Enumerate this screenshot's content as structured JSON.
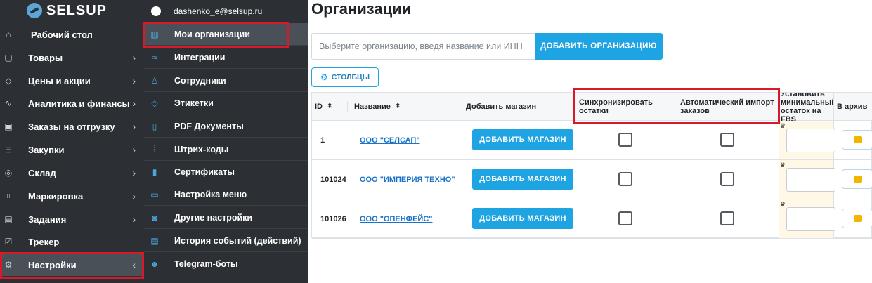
{
  "app": {
    "logo": "SELSUP"
  },
  "sidebar": {
    "items": [
      {
        "label": "Рабочий стол",
        "icon": "home-icon",
        "chevron": ""
      },
      {
        "label": "Товары",
        "icon": "bag-icon",
        "chevron": "›"
      },
      {
        "label": "Цены и акции",
        "icon": "tag-icon",
        "chevron": "›"
      },
      {
        "label": "Аналитика и финансы",
        "icon": "chart-icon",
        "chevron": "›"
      },
      {
        "label": "Заказы на отгрузку",
        "icon": "box-icon",
        "chevron": "›"
      },
      {
        "label": "Закупки",
        "icon": "cart-icon",
        "chevron": "›"
      },
      {
        "label": "Склад",
        "icon": "check-circle-icon",
        "chevron": "›"
      },
      {
        "label": "Маркировка",
        "icon": "scan-icon",
        "chevron": "›"
      },
      {
        "label": "Задания",
        "icon": "calendar-icon",
        "chevron": "›"
      },
      {
        "label": "Трекер",
        "icon": "checkbox-icon",
        "chevron": ""
      },
      {
        "label": "Настройки",
        "icon": "gear-icon",
        "chevron": "‹"
      }
    ]
  },
  "submenu": {
    "user_email": "dashenko_e@selsup.ru",
    "items": [
      {
        "label": "Мои организации",
        "icon": "building-icon"
      },
      {
        "label": "Интеграции",
        "icon": "link-icon"
      },
      {
        "label": "Сотрудники",
        "icon": "user-icon"
      },
      {
        "label": "Этикетки",
        "icon": "tag-icon"
      },
      {
        "label": "PDF Документы",
        "icon": "document-icon"
      },
      {
        "label": "Штрих-коды",
        "icon": "barcode-icon"
      },
      {
        "label": "Сертификаты",
        "icon": "certificate-icon"
      },
      {
        "label": "Настройка меню",
        "icon": "menu-icon"
      },
      {
        "label": "Другие настройки",
        "icon": "settings-icon"
      },
      {
        "label": "История событий (действий)",
        "icon": "history-icon"
      },
      {
        "label": "Telegram-боты",
        "icon": "bot-icon"
      }
    ]
  },
  "main": {
    "title": "Организации",
    "search_placeholder": "Выберите организацию, введя название или ИНН",
    "add_org_label": "ДОБАВИТЬ ОРГАНИЗАЦИЮ",
    "columns_label": "СТОЛБЦЫ",
    "table": {
      "headers": {
        "id": "ID",
        "name": "Название",
        "add_shop": "Добавить магазин",
        "sync": "Синхронизировать остатки",
        "auto_import": "Автоматический импорт заказов",
        "set_stock": "Установить минимальный остаток на FBS",
        "archive": "В архив"
      },
      "rows": [
        {
          "id": "1",
          "name": "ООО \"СЕЛСАП\"",
          "button": "ДОБАВИТЬ МАГАЗИН"
        },
        {
          "id": "101024",
          "name": "ООО \"ИМПЕРИЯ ТЕХНО\"",
          "button": "ДОБАВИТЬ МАГАЗИН"
        },
        {
          "id": "101026",
          "name": "ООО \"ОПЕНФЕЙС\"",
          "button": "ДОБАВИТЬ МАГАЗИН"
        }
      ]
    }
  },
  "colors": {
    "sidebar_bg": "#2c3034",
    "accent": "#1ea4e3",
    "highlight": "#d7192a"
  }
}
